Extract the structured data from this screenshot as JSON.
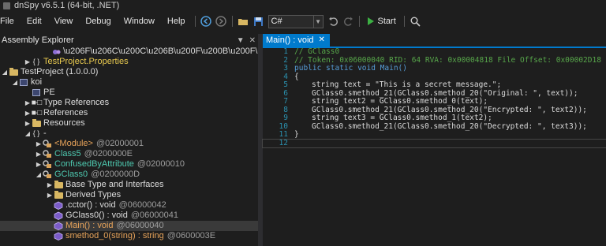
{
  "window": {
    "title": "dnSpy v6.5.1 (64-bit, .NET)"
  },
  "menu": {
    "items": [
      "File",
      "Edit",
      "View",
      "Debug",
      "Window",
      "Help"
    ]
  },
  "toolbar": {
    "language": "C#",
    "start_label": "Start"
  },
  "explorer": {
    "title": "Assembly Explorer",
    "rows": [
      {
        "text": "\\u206F\\u206C\\u200C\\u206B\\u200F\\u200B\\u200F\\u206C",
        "depth": 3,
        "icon": "namespace-icon"
      },
      {
        "text": "TestProject.Properties",
        "depth": 2,
        "icon": "braces-icon",
        "color": "#e8c94f"
      },
      {
        "text": "TestProject (1.0.0.0)",
        "depth": 0,
        "icon": "assembly-icon"
      },
      {
        "text": "koi",
        "depth": 1,
        "icon": "module-icon"
      },
      {
        "text": "PE",
        "depth": 2,
        "icon": "pe-icon"
      },
      {
        "text": "Type References",
        "depth": 2,
        "icon": "reference-icon"
      },
      {
        "text": "References",
        "depth": 2,
        "icon": "reference-icon"
      },
      {
        "text": "Resources",
        "depth": 2,
        "icon": "folder-icon"
      },
      {
        "text": "-",
        "depth": 2,
        "icon": "braces-icon"
      },
      {
        "text": "<Module>",
        "token": "@02000001",
        "depth": 3,
        "icon": "class-icon"
      },
      {
        "text": "Class5",
        "token": "@0200000E",
        "depth": 3,
        "icon": "class-icon"
      },
      {
        "text": "ConfusedByAttribute",
        "token": "@02000010",
        "depth": 3,
        "icon": "class-icon"
      },
      {
        "text": "GClass0",
        "token": "@0200000D",
        "depth": 3,
        "icon": "class-icon"
      },
      {
        "text": "Base Type and Interfaces",
        "depth": 4,
        "icon": "folder-icon"
      },
      {
        "text": "Derived Types",
        "depth": 4,
        "icon": "folder-icon"
      },
      {
        "text": ".cctor() : void",
        "token": "@06000042",
        "depth": 4,
        "icon": "method-icon"
      },
      {
        "text": "GClass0() : void",
        "token": "@06000041",
        "depth": 4,
        "icon": "method-icon"
      },
      {
        "text": "Main() : void",
        "token": "@06000040",
        "depth": 4,
        "icon": "method-icon"
      },
      {
        "text": "smethod_0(string) : string",
        "token": "@0600003E",
        "depth": 4,
        "icon": "method-icon"
      }
    ]
  },
  "editor": {
    "tab_label": "Main() : void",
    "lines": [
      {
        "n": "1",
        "text": "// GClass0"
      },
      {
        "n": "2",
        "text": "// Token: 0x06000040 RID: 64 RVA: 0x00004818 File Offset: 0x00002D18"
      },
      {
        "n": "3",
        "text": "public static void Main()"
      },
      {
        "n": "4",
        "text": "{"
      },
      {
        "n": "5",
        "text": "string text = \"This is a secret message.\";"
      },
      {
        "n": "6",
        "text": "GClass0.smethod_21(GClass0.smethod_20(\"Original: \", text));"
      },
      {
        "n": "7",
        "text": "string text2 = GClass0.smethod_0(text);"
      },
      {
        "n": "8",
        "text": "GClass0.smethod_21(GClass0.smethod_20(\"Encrypted: \", text2));"
      },
      {
        "n": "9",
        "text": "string text3 = GClass0.smethod_1(text2);"
      },
      {
        "n": "10",
        "text": "GClass0.smethod_21(GClass0.smethod_20(\"Decrypted: \", text3));"
      },
      {
        "n": "11",
        "text": "}"
      },
      {
        "n": "12",
        "text": ""
      }
    ]
  }
}
